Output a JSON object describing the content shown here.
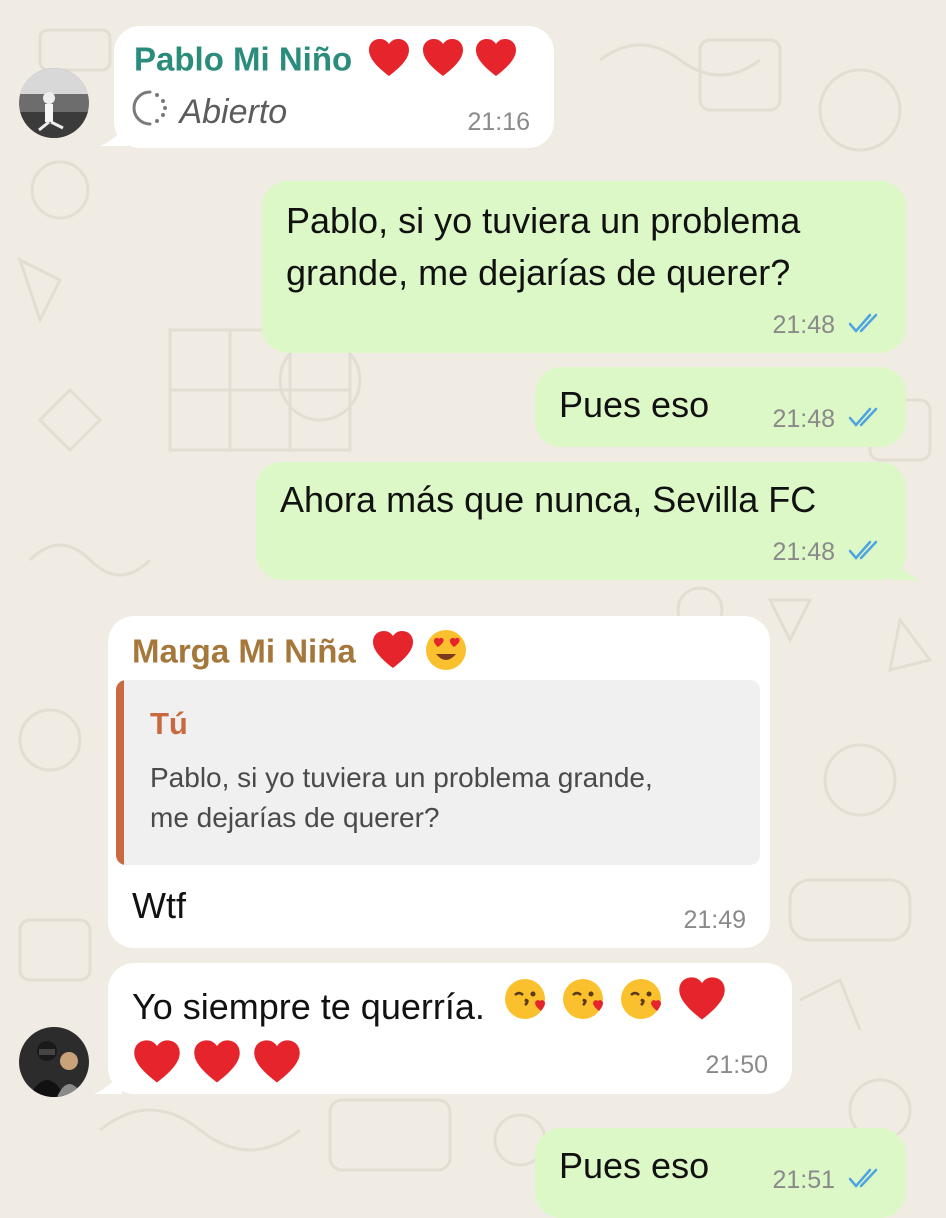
{
  "messages": [
    {
      "id": "m1",
      "direction": "incoming",
      "sender": "Pablo Mi Niño",
      "sender_color": "#2a8c7a",
      "sender_emojis": [
        "red-heart",
        "red-heart",
        "red-heart"
      ],
      "status_text": "Abierto",
      "time": "21:16"
    },
    {
      "id": "m2",
      "direction": "outgoing",
      "lines": [
        "Pablo, si yo tuviera un problema",
        "grande, me dejarías de querer?"
      ],
      "time": "21:48",
      "read": true
    },
    {
      "id": "m3",
      "direction": "outgoing",
      "text": "Pues eso",
      "time": "21:48",
      "read": true
    },
    {
      "id": "m4",
      "direction": "outgoing",
      "text": "Ahora más que nunca, Sevilla FC",
      "time": "21:48",
      "read": true
    },
    {
      "id": "m5",
      "direction": "incoming",
      "sender": "Marga Mi Niña",
      "sender_color": "#a5773b",
      "sender_emojis": [
        "red-heart",
        "heart-eyes"
      ],
      "quote": {
        "author": "Tú",
        "author_color": "#c9693f",
        "lines": [
          "Pablo, si yo tuviera un problema grande,",
          "me dejarías de querer?"
        ]
      },
      "text": "Wtf",
      "time": "21:49"
    },
    {
      "id": "m6",
      "direction": "incoming",
      "text": "Yo siempre te querría.",
      "emojis_line1": [
        "kiss-face",
        "kiss-face",
        "kiss-face",
        "red-heart"
      ],
      "emojis_line2": [
        "red-heart",
        "red-heart",
        "red-heart"
      ],
      "time": "21:50"
    },
    {
      "id": "m7",
      "direction": "outgoing",
      "text": "Pues eso",
      "time": "21:51",
      "read": true
    }
  ],
  "colors": {
    "incoming_bubble": "#ffffff",
    "outgoing_bubble": "#dcf8c6",
    "read_ticks": "#4fa3e0",
    "wallpaper": "#f0ece4"
  }
}
